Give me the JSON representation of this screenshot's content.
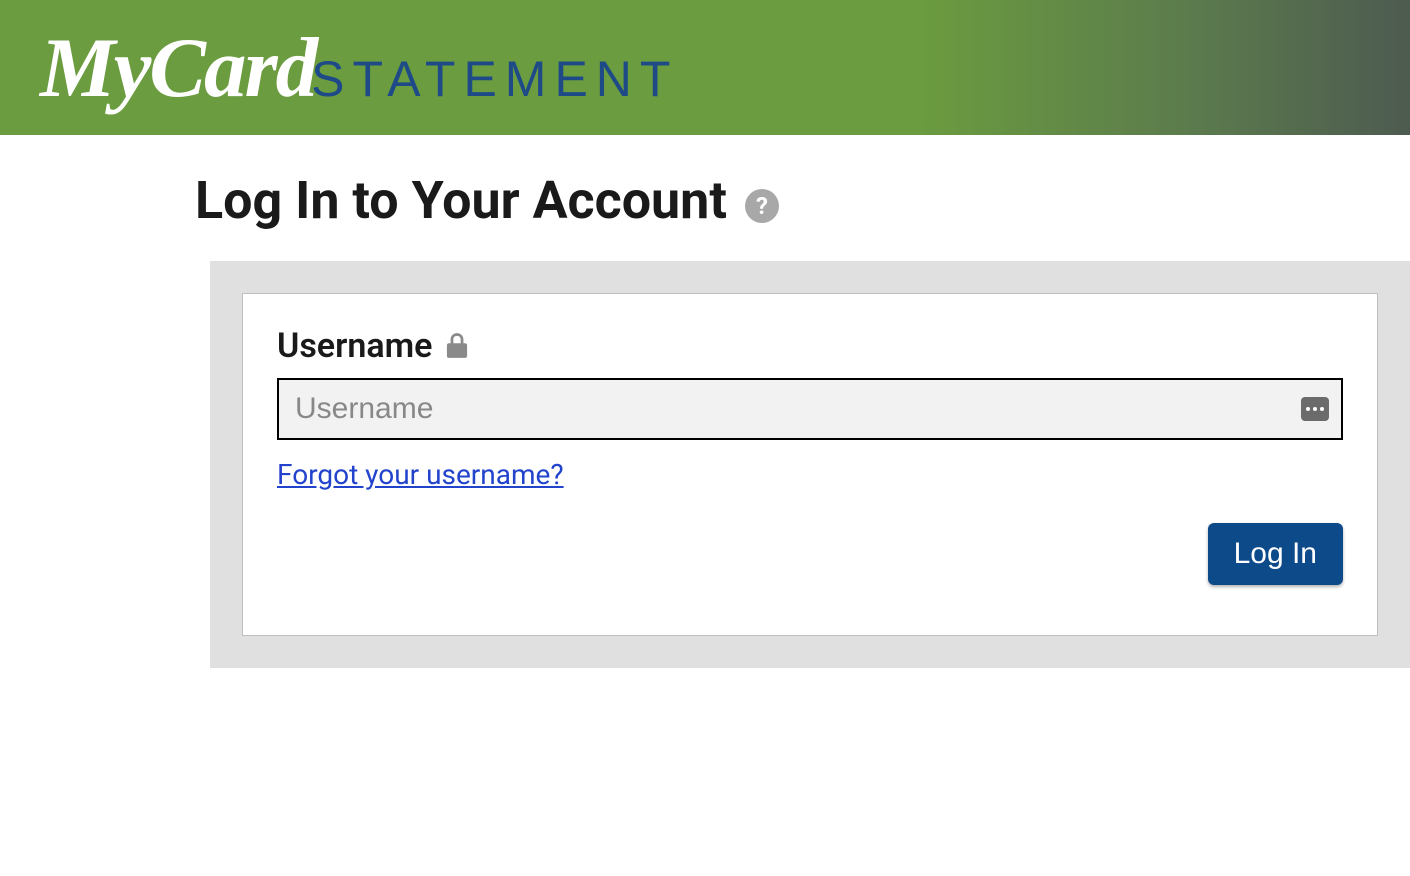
{
  "brand": {
    "logo_part1": "MyCard",
    "logo_part2": "STATEMENT"
  },
  "page": {
    "title": "Log In to Your Account",
    "help_glyph": "?"
  },
  "login": {
    "username_label": "Username",
    "username_placeholder": "Username",
    "username_value": "",
    "forgot_link": "Forgot your username?",
    "submit_label": "Log In"
  }
}
